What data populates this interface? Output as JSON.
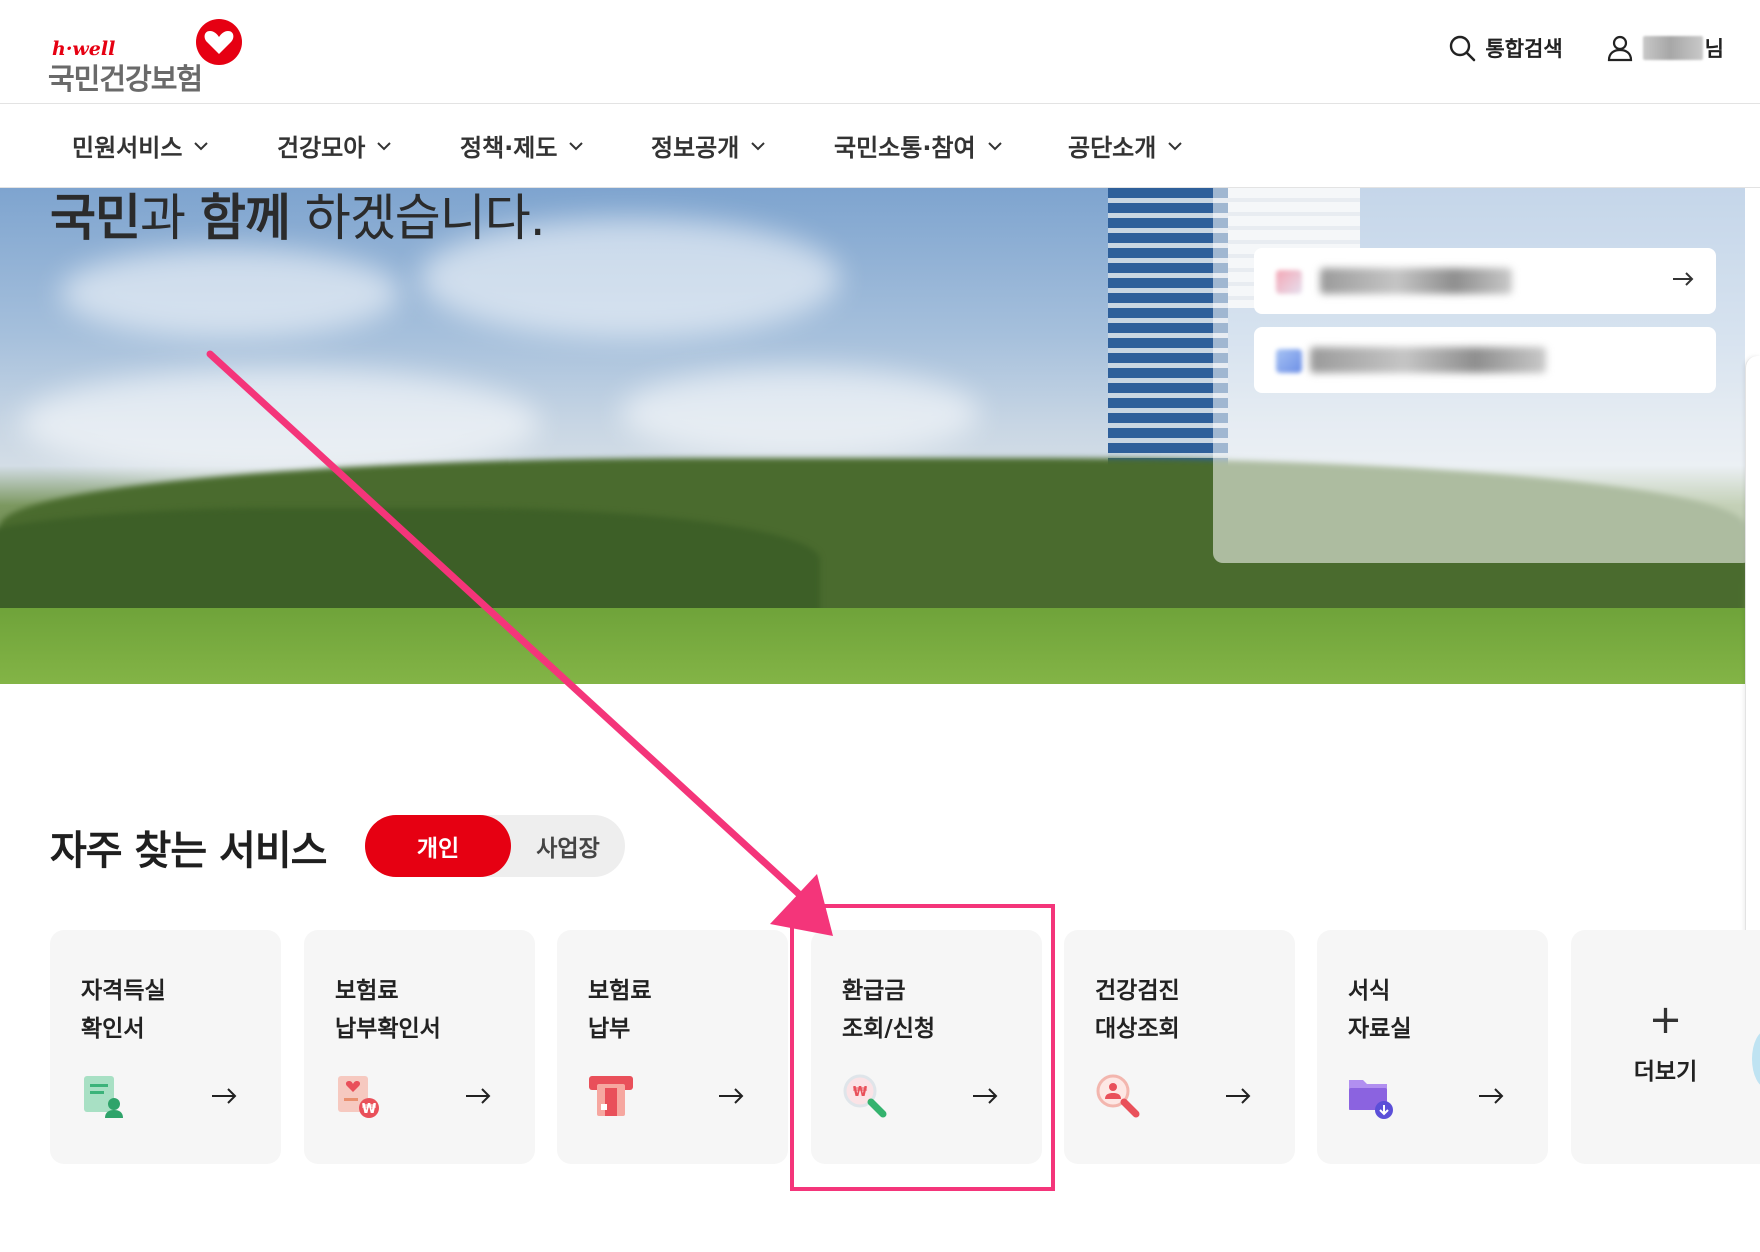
{
  "header": {
    "logo_sub": "h·well",
    "logo_main": "국민건강보험",
    "search_label": "통합검색",
    "user_suffix": "님"
  },
  "nav": {
    "items": [
      {
        "label": "민원서비스"
      },
      {
        "label": "건강모아"
      },
      {
        "label": "정책·제도"
      },
      {
        "label": "정보공개"
      },
      {
        "label": "국민소통·참여"
      },
      {
        "label": "공단소개"
      }
    ]
  },
  "hero": {
    "title_part1": "국민",
    "title_part2": "과 ",
    "title_part3": "함께",
    "title_part4": " 하겠습니다."
  },
  "frequent": {
    "title": "자주 찾는 서비스",
    "tab_personal": "개인",
    "tab_business": "사업장",
    "services": [
      {
        "line1": "자격득실",
        "line2": "확인서",
        "icon": "certificate-icon"
      },
      {
        "line1": "보험료",
        "line2": "납부확인서",
        "icon": "payment-certificate-icon"
      },
      {
        "line1": "보험료",
        "line2": "납부",
        "icon": "card-payment-icon"
      },
      {
        "line1": "환급금",
        "line2": "조회/신청",
        "icon": "refund-search-icon"
      },
      {
        "line1": "건강검진",
        "line2": "대상조회",
        "icon": "checkup-search-icon"
      },
      {
        "line1": "서식",
        "line2": "자료실",
        "icon": "folder-download-icon"
      }
    ],
    "more_label": "더보기"
  },
  "colors": {
    "brand_red": "#e60012",
    "annotation_pink": "#f4357a"
  }
}
